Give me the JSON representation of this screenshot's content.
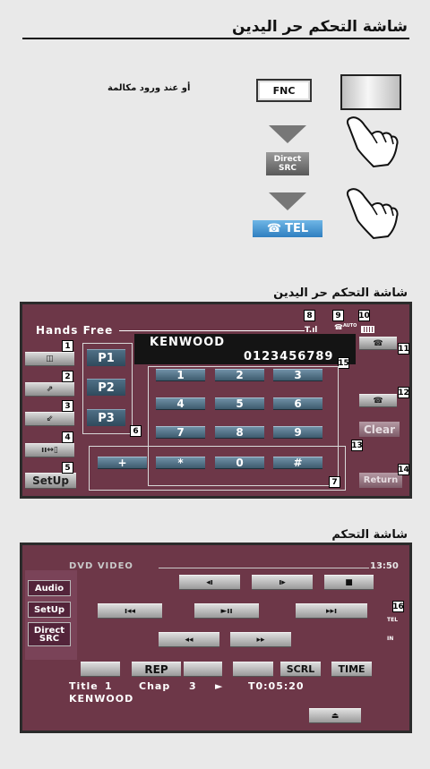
{
  "intro": {
    "title": "شاشة التحكم حر اليدين",
    "note": "أو عند ورود مكالمة",
    "fnc_label": "FNC",
    "direct_src_label": "Direct SRC",
    "tel_label": "TEL"
  },
  "handsfree": {
    "section_title": "شاشة التحكم حر اليدين",
    "header_label": "Hands Free",
    "device_name": "KENWOOD",
    "phone_number": "0123456789",
    "presets": [
      "P1",
      "P2",
      "P3"
    ],
    "keypad": [
      "1",
      "2",
      "3",
      "4",
      "5",
      "6",
      "7",
      "8",
      "9",
      "+",
      "*",
      "0",
      "#"
    ],
    "setup_label": "SetUp",
    "clear_label": "Clear",
    "return_label": "Return",
    "auto_label": "AUTO",
    "callouts": [
      "1",
      "2",
      "3",
      "4",
      "5",
      "6",
      "7",
      "8",
      "9",
      "10",
      "11",
      "12",
      "13",
      "14",
      "15"
    ]
  },
  "control": {
    "section_title": "شاشة التحكم",
    "source_label": "DVD VIDEO",
    "clock": "13:50",
    "side_buttons": [
      "Audio",
      "SetUp",
      "Direct SRC"
    ],
    "rep_label": "REP",
    "scrl_label": "SCRL",
    "time_label": "TIME",
    "info_title": "Title",
    "info_title_value": "1",
    "info_chap": "Chap",
    "info_chap_value": "3",
    "info_play_glyph": "►",
    "info_time": "T0:05:20",
    "info_name": "KENWOOD",
    "callout_16": "16",
    "tel_indicator": "TEL",
    "in_indicator": "IN"
  },
  "icons": {
    "hand": "pointing-hand-icon",
    "phone": "phone-icon",
    "phonebook": "phonebook-icon",
    "signal": "signal-strength-icon",
    "battery": "battery-icon",
    "eject": "eject-icon"
  },
  "colors": {
    "panel_background": "#6d3748",
    "page_background": "#e9e9e9",
    "key_blue": "#4c6b80",
    "tel_blue": "#3b8fd0"
  }
}
